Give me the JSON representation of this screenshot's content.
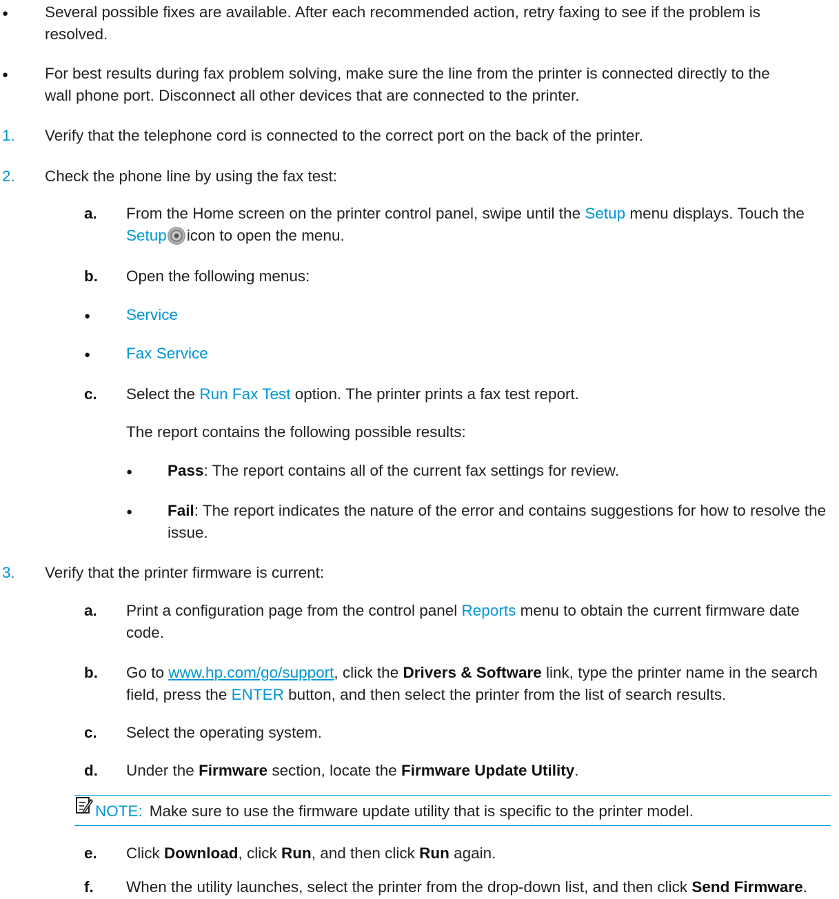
{
  "intro": {
    "bullet1": [
      "Several possible fixes are available. After each recommended action, retry faxing to see if the problem is",
      "resolved."
    ],
    "bullet2": [
      "For best results during fax problem solving, make sure the line from the printer is connected directly to the",
      "wall phone port. Disconnect all other devices that are connected to the printer."
    ]
  },
  "step1": {
    "num": "1.",
    "text": "Verify that the telephone cord is connected to the correct port on the back of the printer."
  },
  "step2": {
    "num": "2.",
    "text": "Check the phone line by using the fax test:",
    "a": {
      "label": "a.",
      "t1": "From the Home screen on the printer control panel, swipe until the ",
      "setup": "Setup",
      "t2": " menu displays. Touch the",
      "setup2": "Setup",
      "t3": "icon to open the menu."
    },
    "b": {
      "label": "b.",
      "text": "Open the following menus:",
      "menus": [
        "Service",
        "Fax Service"
      ]
    },
    "c": {
      "label": "c.",
      "t1": "Select the ",
      "ui": "Run Fax Test",
      "t2": " option. The printer prints a fax test report.",
      "para": "The report contains the following possible results:",
      "pass_label": "Pass",
      "pass_text": ": The report contains all of the current fax settings for review.",
      "fail_label": "Fail",
      "fail_text": ": The report indicates the nature of the error and contains suggestions for how to resolve the",
      "fail_text2": "issue."
    }
  },
  "step3": {
    "num": "3.",
    "text": "Verify that the printer firmware is current:",
    "a": {
      "label": "a.",
      "t1": "Print a configuration page from the control panel ",
      "ui": "Reports",
      "t2": " menu to obtain the current firmware date",
      "t3": "code."
    },
    "b": {
      "label": "b.",
      "t1": "Go to ",
      "link": "www.hp.com/go/support",
      "t2": ", click the ",
      "b1": "Drivers & Software",
      "t3": " link, type the printer name in the search",
      "t4": "field, press the ",
      "ui": "ENTER",
      "t5": " button, and then select the printer from the list of search results."
    },
    "c": {
      "label": "c.",
      "text": "Select the operating system."
    },
    "d": {
      "label": "d.",
      "t1": "Under the ",
      "b1": "Firmware",
      "t2": " section, locate the ",
      "b2": "Firmware Update Utility",
      "t3": "."
    },
    "note": {
      "label": "NOTE:",
      "text": "Make sure to use the firmware update utility that is specific to the printer model."
    },
    "e": {
      "label": "e.",
      "t1": "Click ",
      "b1": "Download",
      "t2": ", click ",
      "b2": "Run",
      "t3": ", and then click ",
      "b3": "Run",
      "t4": " again."
    },
    "f": {
      "label": "f.",
      "t1": "When the utility launches, select the printer from the drop-down list, and then click ",
      "b1": "Send Firmware",
      "t2": "."
    }
  },
  "colors": {
    "accent": "#0096d6",
    "text": "#222222"
  }
}
